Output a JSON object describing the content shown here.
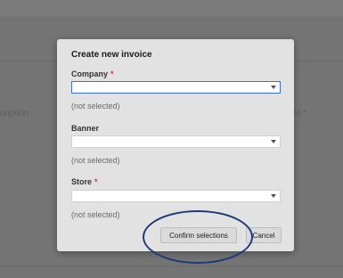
{
  "background": {
    "left_label": "cription",
    "right_label": "vl *"
  },
  "modal": {
    "title": "Create new invoice",
    "fields": [
      {
        "label": "Company",
        "required": "*",
        "hint": "(not selected)"
      },
      {
        "label": "Banner",
        "required": "",
        "hint": "(not selected)"
      },
      {
        "label": "Store",
        "required": "*",
        "hint": "(not selected)"
      }
    ],
    "buttons": {
      "confirm": "Confirm selections",
      "cancel": "Cancel"
    }
  },
  "colors": {
    "required": "#d33333",
    "focus": "#3a6fd8",
    "annotation": "#1f3a7a"
  },
  "icons": [
    "chevron-down-icon"
  ]
}
